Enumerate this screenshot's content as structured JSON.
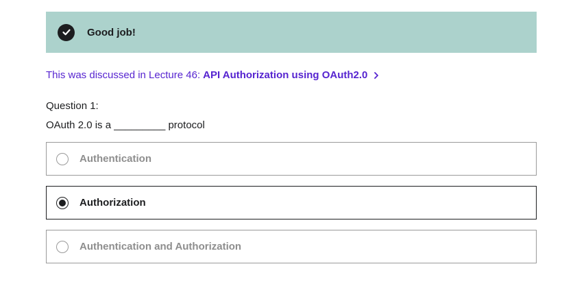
{
  "banner": {
    "title": "Good job!",
    "icon": "check-circle-icon",
    "background": "#acd2cc"
  },
  "lecture_link": {
    "prefix": "This was discussed in Lecture 46:",
    "title": "API Authorization using OAuth2.0",
    "icon": "chevron-right-icon",
    "color": "#5624d0"
  },
  "question": {
    "label": "Question 1:",
    "text": "OAuth 2.0 is a _________ protocol"
  },
  "options": [
    {
      "label": "Authentication",
      "selected": false
    },
    {
      "label": "Authorization",
      "selected": true
    },
    {
      "label": "Authentication and Authorization",
      "selected": false
    }
  ]
}
